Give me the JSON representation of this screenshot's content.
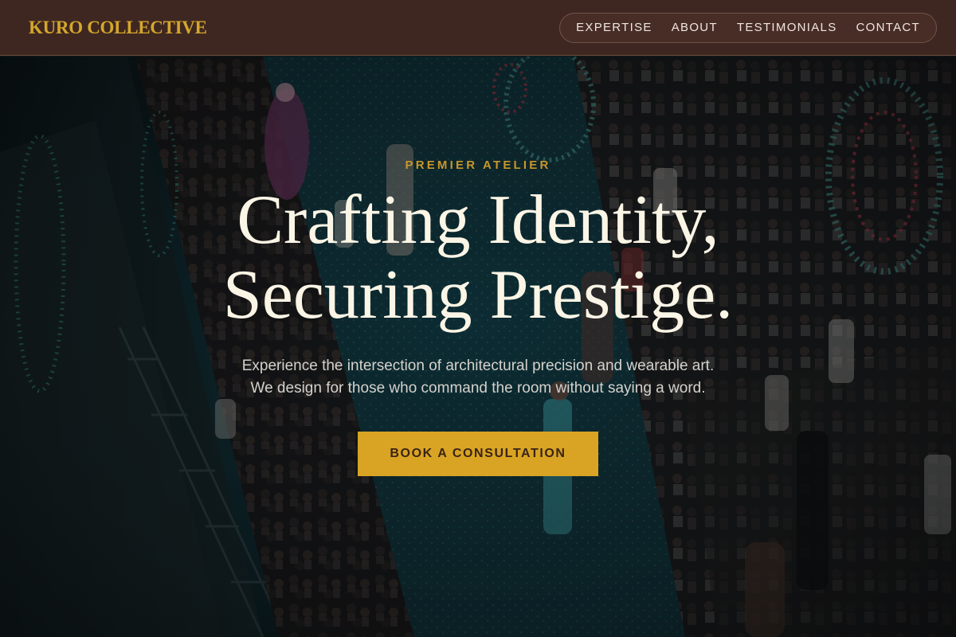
{
  "brand": {
    "name": "KURO COLLECTIVE",
    "color": "#d4a72c"
  },
  "nav": {
    "items": [
      {
        "label": "EXPERTISE"
      },
      {
        "label": "ABOUT"
      },
      {
        "label": "TESTIMONIALS"
      },
      {
        "label": "CONTACT"
      }
    ]
  },
  "hero": {
    "eyebrow": "PREMIER ATELIER",
    "headline_line1": "Crafting Identity,",
    "headline_line2": "Securing Prestige.",
    "sub_line1": "Experience the intersection of architectural precision and wearable art.",
    "sub_line2": "We design for those who command the room without saying a word.",
    "cta_label": "BOOK A CONSULTATION",
    "background": "runway-fashion-show-photo"
  },
  "colors": {
    "header_bg": "#3f2721",
    "accent": "#d9a423",
    "headline": "#fbf5e6"
  }
}
